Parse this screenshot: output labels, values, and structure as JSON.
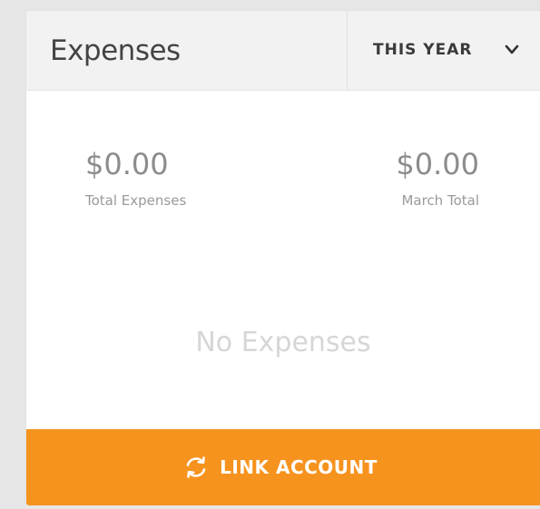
{
  "widget": {
    "title": "Expenses",
    "period": {
      "label": "THIS YEAR",
      "icon": "chevron-down-icon"
    }
  },
  "stats": [
    {
      "value": "$0.00",
      "label": "Total Expenses"
    },
    {
      "value": "$0.00",
      "label": "March Total"
    }
  ],
  "empty_message": "No Expenses",
  "action": {
    "label": "LINK ACCOUNT",
    "icon": "sync-icon"
  },
  "colors": {
    "accent": "#f6931e",
    "header_bg": "#f2f2f2",
    "page_bg": "#e6e6e6"
  }
}
